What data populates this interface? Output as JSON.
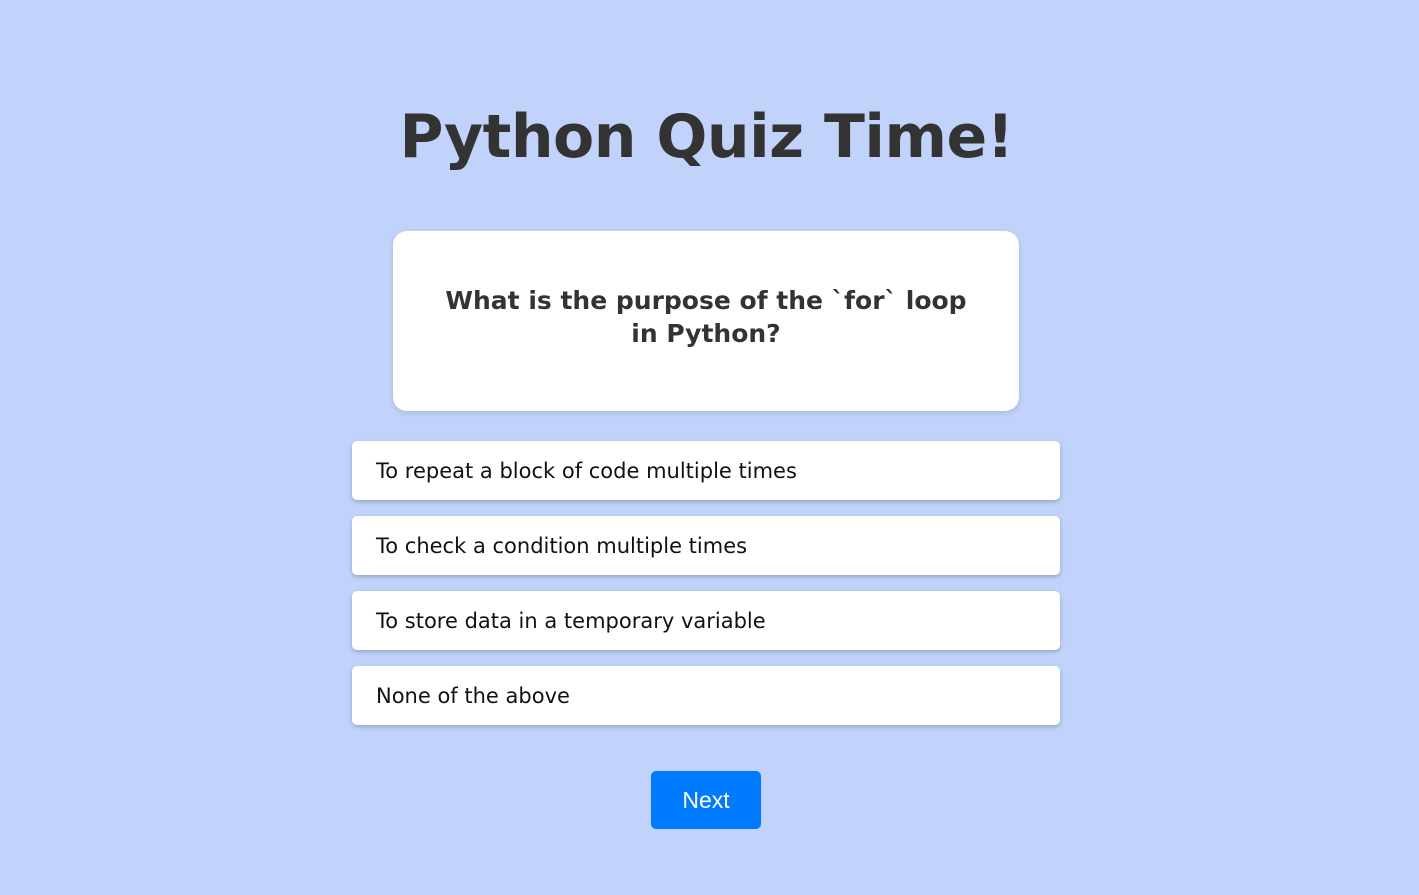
{
  "page": {
    "title": "Python Quiz Time!"
  },
  "question": {
    "text": "What is the purpose of the `for` loop in Python?"
  },
  "answers": [
    {
      "label": "To repeat a block of code multiple times"
    },
    {
      "label": "To check a condition multiple times"
    },
    {
      "label": "To store data in a temporary variable"
    },
    {
      "label": "None of the above"
    }
  ],
  "controls": {
    "next_label": "Next"
  },
  "colors": {
    "background": "#c1d3fa",
    "accent": "#007bff",
    "text": "#333333"
  }
}
